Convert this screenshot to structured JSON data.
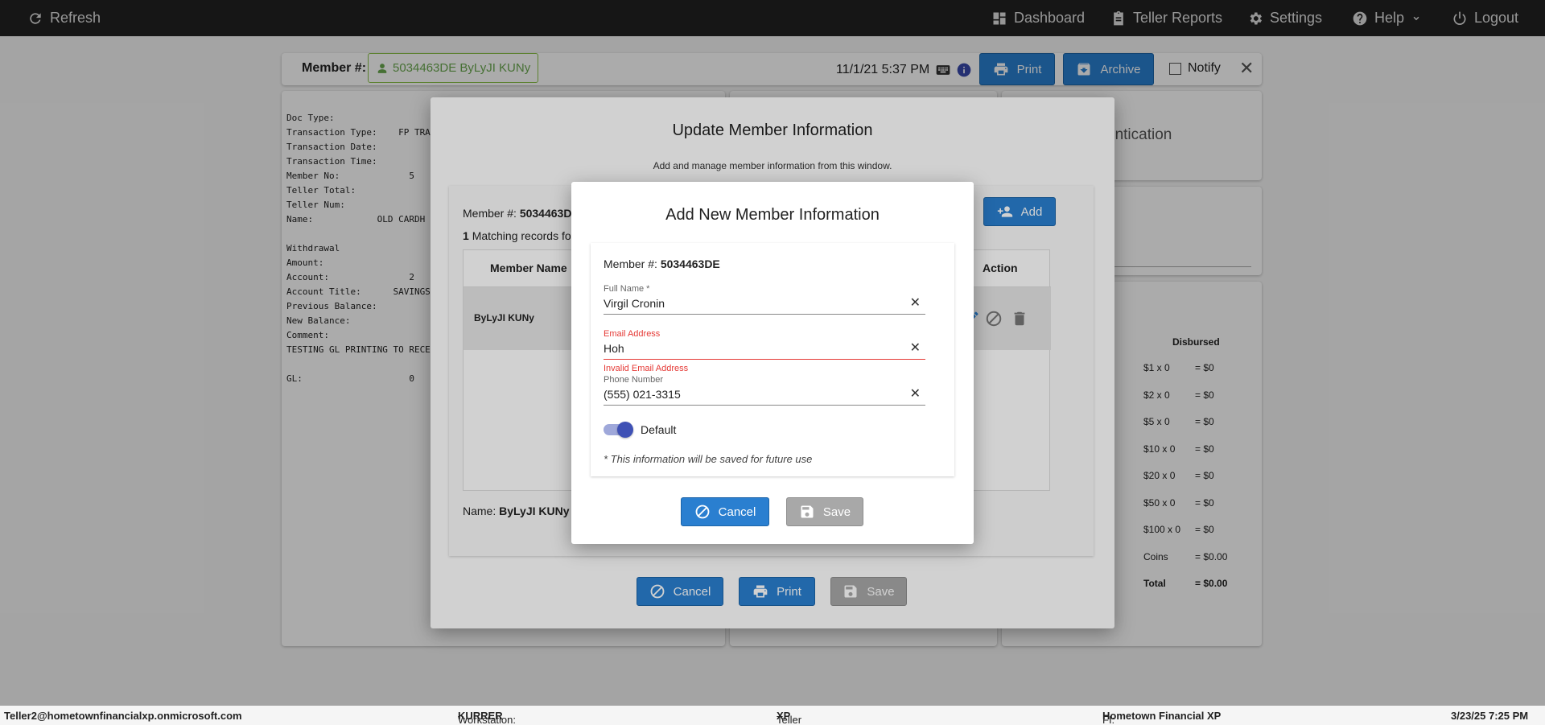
{
  "topbar": {
    "refresh": "Refresh",
    "dashboard": "Dashboard",
    "teller_reports": "Teller Reports",
    "settings": "Settings",
    "help": "Help",
    "logout": "Logout"
  },
  "header": {
    "member_label": "Member #:",
    "member_chip": "5034463DE ByLyJI KUNy",
    "datetime": "11/1/21 5:37 PM",
    "print": "Print",
    "archive": "Archive",
    "notify": "Notify"
  },
  "receipt": {
    "lines": "Doc Type:\nTransaction Type:    FP TRA\nTransaction Date:\nTransaction Time:\nMember No:             5\nTeller Total:\nTeller Num:\nName:            OLD CARDH\n\nWithdrawal\nAmount:\nAccount:               2\nAccount Title:      SAVINGS\nPrevious Balance:\nNew Balance:\nComment:\nTESTING GL PRINTING TO RECE\n\nGL:                    0"
  },
  "right_panel": {
    "auth_title": "entication",
    "disbursed_header": "Disbursed",
    "rows": [
      {
        "label": "$1 x 0",
        "value": "= $0"
      },
      {
        "label": "$2 x 0",
        "value": "= $0"
      },
      {
        "label": "$5 x 0",
        "value": "= $0"
      },
      {
        "label": "$10 x 0",
        "value": "= $0"
      },
      {
        "label": "$20 x 0",
        "value": "= $0"
      },
      {
        "label": "$50 x 0",
        "value": "= $0"
      },
      {
        "label": "$100 x 0",
        "value": "= $0"
      },
      {
        "label": "Coins",
        "value": "= $0.00"
      },
      {
        "label": "Total",
        "value": "= $0.00"
      }
    ]
  },
  "update_dialog": {
    "title": "Update Member Information",
    "subtitle": "Add and manage member information from this window.",
    "member_label": "Member #:",
    "member_value": "5034463D",
    "add": "Add",
    "matching_count": "1",
    "matching_text": "Matching records fo",
    "col_member_name": "Member Name",
    "col_action": "Action",
    "row_name": "ByLyJI KUNy",
    "name_label": "Name:",
    "name_value": "ByLyJI KUNy",
    "cancel": "Cancel",
    "print": "Print",
    "save": "Save"
  },
  "add_dialog": {
    "title": "Add New Member Information",
    "member_label": "Member #:",
    "member_value": "5034463DE",
    "full_name_label": "Full Name *",
    "full_name_value": "Virgil Cronin",
    "email_label": "Email Address",
    "email_value": "Hoh",
    "email_error": "Invalid Email Address",
    "phone_label": "Phone Number",
    "phone_value": "(555) 021-3315",
    "default_label": "Default",
    "note": "* This information will be saved for future use",
    "cancel": "Cancel",
    "save": "Save"
  },
  "footer": {
    "user": "Teller2@hometownfinancialxp.onmicrosoft.com",
    "workstation_label": "Workstation:",
    "workstation_value": "KURRER",
    "platform_label": "Teller Platform:",
    "platform_value": "XP",
    "fi_label": "FI:",
    "fi_value": "Hometown Financial XP",
    "datetime": "3/23/25 7:25 PM"
  },
  "colors": {
    "primary": "#2a7fd0",
    "error": "#e53935",
    "chip_green": "#6aa84f",
    "toggle": "#3f51b5"
  }
}
